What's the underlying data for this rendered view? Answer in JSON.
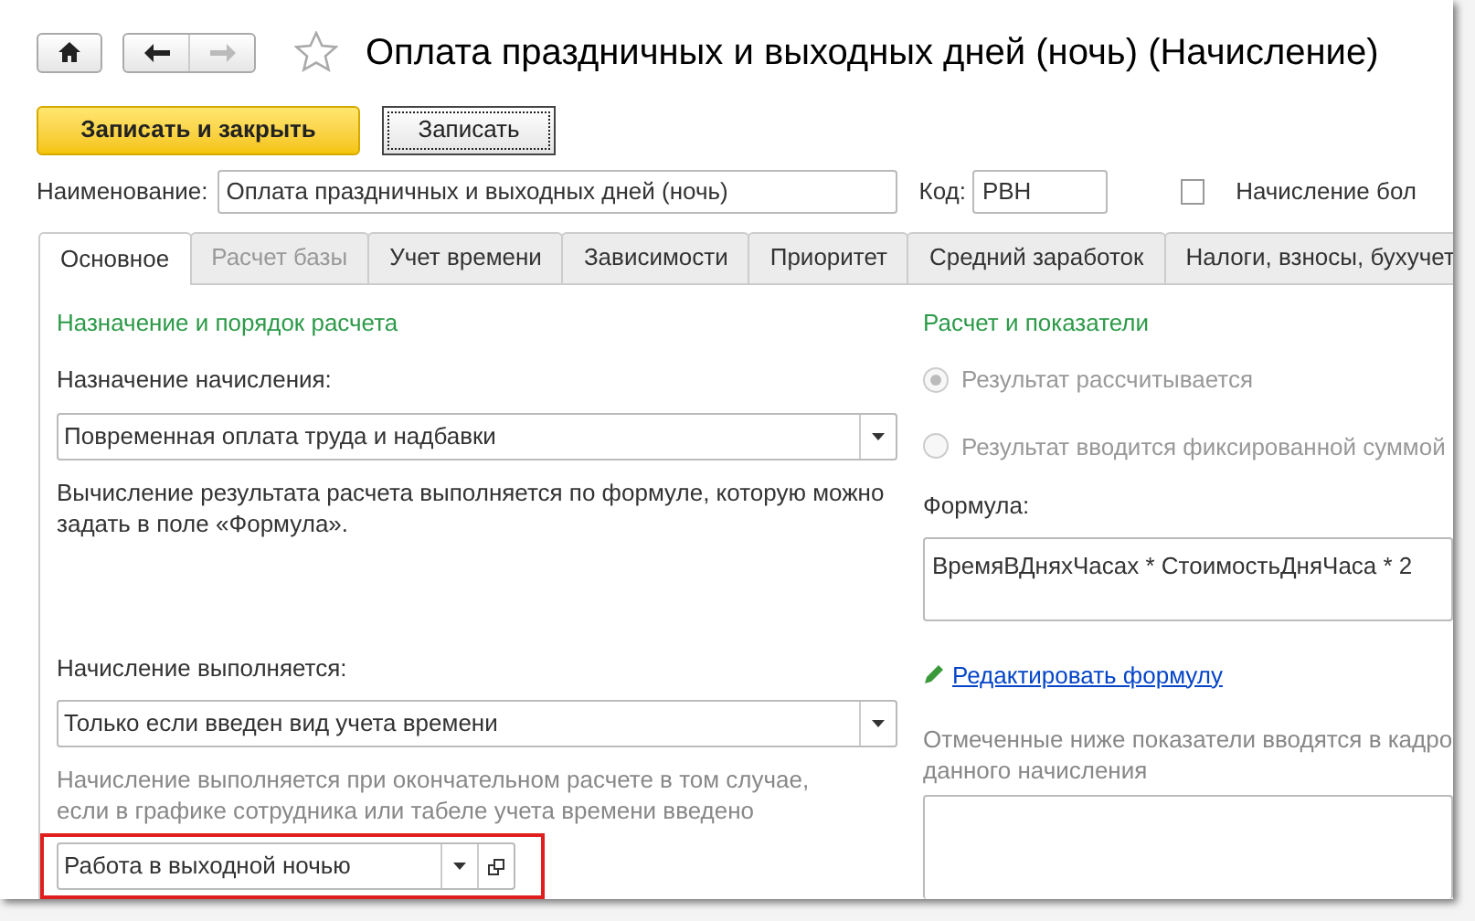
{
  "window": {
    "title": "Оплата праздничных и выходных дней (ночь) (Начисление)"
  },
  "toolbar": {
    "buttons": [
      {
        "label": "Записать и закрыть",
        "kind": "primary"
      },
      {
        "label": "Записать",
        "kind": "default"
      }
    ]
  },
  "header": {
    "name_label": "Наименование:",
    "name_value": "Оплата праздничных и выходных дней (ночь)",
    "code_label": "Код:",
    "code_value": "РВН",
    "checkbox": {
      "label": "Начисление бол",
      "checked": false
    }
  },
  "tabs": [
    {
      "label": "Основное",
      "selected": true,
      "disabled": false
    },
    {
      "label": "Расчет базы",
      "selected": false,
      "disabled": true
    },
    {
      "label": "Учет времени",
      "selected": false,
      "disabled": false
    },
    {
      "label": "Зависимости",
      "selected": false,
      "disabled": false
    },
    {
      "label": "Приоритет",
      "selected": false,
      "disabled": false
    },
    {
      "label": "Средний заработок",
      "selected": false,
      "disabled": false
    },
    {
      "label": "Налоги, взносы, бухучет",
      "selected": false,
      "disabled": false
    }
  ],
  "left": {
    "heading": "Назначение и порядок расчета",
    "purpose_label": "Назначение начисления:",
    "purpose_value": "Повременная оплата труда и надбавки",
    "purpose_note": "Вычисление результата расчета выполняется по формуле, которую можно задать в поле «Формула».",
    "exec_label": "Начисление выполняется:",
    "exec_value": "Только если введен вид учета времени",
    "exec_note": "Начисление выполняется при окончательном расчете в том случае, если в графике сотрудника или табеле учета времени введено",
    "time_type_value": "Работа в выходной ночью",
    "highlighted": true
  },
  "right": {
    "heading": "Расчет и показатели",
    "radios": [
      {
        "label": "Результат рассчитывается",
        "selected": true,
        "disabled": true
      },
      {
        "label": "Результат вводится фиксированной суммой",
        "selected": false,
        "disabled": true
      }
    ],
    "formula_label": "Формула:",
    "formula_value": "ВремяВДняхЧасах * СтоимостьДняЧаса * 2",
    "edit_link": "Редактировать формулу",
    "indicators_note": "Отмеченные ниже показатели вводятся в кадро данного начисления"
  }
}
